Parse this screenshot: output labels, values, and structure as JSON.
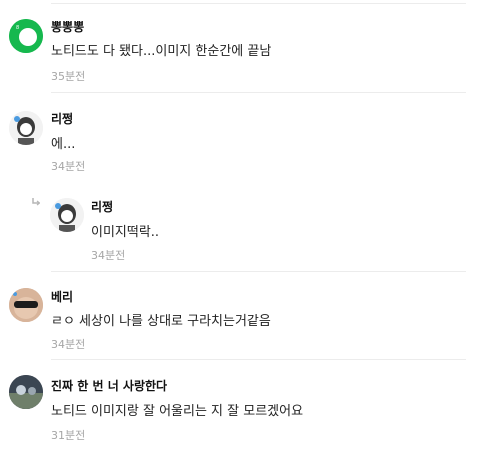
{
  "comments": [
    {
      "name": "뽕뽕뽕",
      "text": "노티드도 다 됐다...이미지 한순간에 끝남",
      "time": "35분전"
    },
    {
      "name": "리쩡",
      "text": "에...",
      "time": "34분전"
    },
    {
      "name": "리쩡",
      "text": "이미지떡락..",
      "time": "34분전",
      "reply": true
    },
    {
      "name": "베리",
      "text": "ㄹㅇ 세상이 나를 상대로 구라치는거같음",
      "time": "34분전"
    },
    {
      "name": "진짜 한 번 너 사랑한다",
      "text": "노티드 이미지랑 잘 어울리는 지 잘 모르겠어요",
      "time": "31분전"
    }
  ],
  "colors": {
    "avatar_green": "#16b84e",
    "timestamp": "#a6a6a6",
    "divider": "#ececec"
  }
}
